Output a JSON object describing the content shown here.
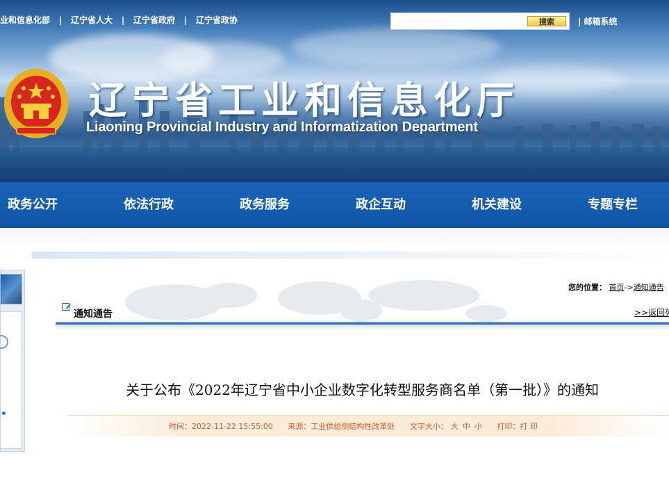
{
  "top_links": [
    "业和信息化部",
    "辽宁省人大",
    "辽宁省政府",
    "辽宁省政协"
  ],
  "top_separator": "|",
  "search": {
    "placeholder": "",
    "button_label": "搜索"
  },
  "mail_link": "| 邮箱系统",
  "site": {
    "title_cn": "辽宁省工业和信息化厅",
    "title_en": "Liaoning Provincial Industry and Informatization Department"
  },
  "nav": [
    "政务公开",
    "依法行政",
    "政务服务",
    "政企互动",
    "机关建设",
    "专题专栏"
  ],
  "location": {
    "label": "您的位置：",
    "home": "首页",
    "arrow": "->",
    "current": "通知通告"
  },
  "section": {
    "title": "通知通告",
    "back_link": ">>返回列表"
  },
  "article": {
    "title": "关于公布《2022年辽宁省中小企业数字化转型服务商名单（第一批）》的通知",
    "time_label": "时间：",
    "time": "2022-11-22 15:55:00",
    "source_label": "来源：",
    "source": "工业供给侧结构性改革处",
    "font_size_label": "文字大小：",
    "font_sizes": [
      "大",
      "中",
      "小"
    ],
    "print_label": "打印：",
    "print_action": "打 印"
  },
  "colors": {
    "nav_bg": "#1560b2",
    "meta_text": "#d2592a",
    "meta_bg": "#fbecd9",
    "accent_line": "#2c67b3"
  },
  "icons": {
    "emblem": "national-emblem-icon",
    "section": "edit-note-icon"
  }
}
